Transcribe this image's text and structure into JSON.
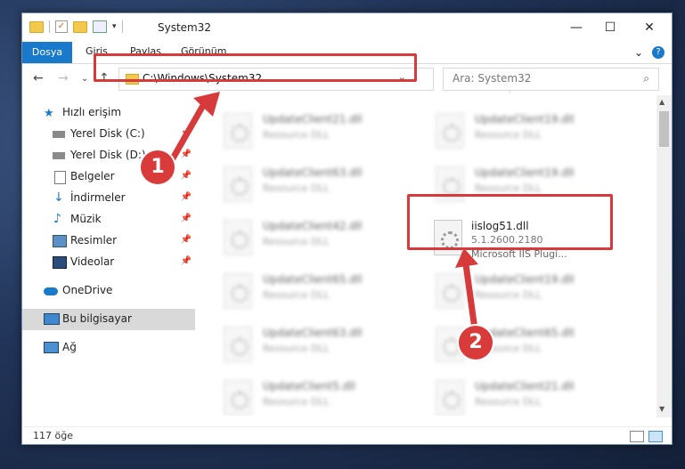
{
  "window": {
    "title": "System32",
    "controls": {
      "minimize": "—",
      "maximize": "☐",
      "close": "✕"
    }
  },
  "ribbon": {
    "file_tab": "Dosya",
    "tabs": [
      "Giriş",
      "Paylaş",
      "Görünüm"
    ],
    "expand": "⌄",
    "help": "?"
  },
  "nav": {
    "back": "←",
    "forward": "→",
    "recent": "⌄",
    "up": "↑",
    "address": "C:\\Windows\\System32",
    "address_chevron": "⌄",
    "refresh": "↻",
    "search_placeholder": "Ara: System32"
  },
  "sidebar": {
    "items": [
      {
        "label": "Hızlı erişim",
        "icon": "star-icon",
        "pinned": false
      },
      {
        "label": "Yerel Disk (C:)",
        "icon": "drive-icon",
        "pinned": true
      },
      {
        "label": "Yerel Disk (D:)",
        "icon": "drive-icon",
        "pinned": true
      },
      {
        "label": "Belgeler",
        "icon": "documents-icon",
        "pinned": true
      },
      {
        "label": "İndirmeler",
        "icon": "download-icon",
        "pinned": true
      },
      {
        "label": "Müzik",
        "icon": "music-icon",
        "pinned": true
      },
      {
        "label": "Resimler",
        "icon": "pictures-icon",
        "pinned": true
      },
      {
        "label": "Videolar",
        "icon": "videos-icon",
        "pinned": true
      },
      {
        "label": "OneDrive",
        "icon": "cloud-icon",
        "pinned": false
      },
      {
        "label": "Bu bilgisayar",
        "icon": "computer-icon",
        "pinned": false,
        "selected": true
      },
      {
        "label": "Ağ",
        "icon": "network-icon",
        "pinned": false
      }
    ]
  },
  "files": {
    "left": [
      {
        "name": "UpdateClient21.dll",
        "type": "Resource DLL"
      },
      {
        "name": "UpdateClient63.dll",
        "type": "Resource DLL"
      },
      {
        "name": "UpdateClient42.dll",
        "type": "Resource DLL"
      },
      {
        "name": "UpdateClient65.dll",
        "type": "Resource DLL"
      },
      {
        "name": "UpdateClient63.dll",
        "type": "Resource DLL"
      },
      {
        "name": "UpdateClient5.dll",
        "type": "Resource DLL"
      }
    ],
    "right": [
      {
        "name": "UpdateClient19.dll",
        "type": "Resource DLL"
      },
      {
        "name": "UpdateClient19.dll",
        "type": "Resource DLL"
      },
      {
        "name": "UpdateClient65.dll",
        "type": "Resource DLL"
      },
      {
        "name": "UpdateClient21.dll",
        "type": "Resource DLL"
      }
    ],
    "highlighted": {
      "name": "iislog51.dll",
      "version": "5.1.2600.2180",
      "description": "Microsoft IIS Plugi..."
    }
  },
  "status": {
    "count": "117 öğe"
  },
  "markers": {
    "one": "1",
    "two": "2"
  },
  "colors": {
    "accent": "#1979ca",
    "highlight_red": "#d63a3a"
  }
}
